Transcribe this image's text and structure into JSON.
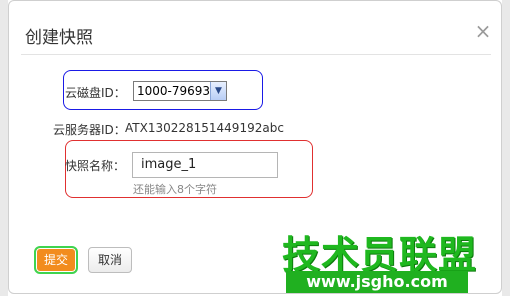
{
  "dialog": {
    "title": "创建快照",
    "close_glyph": "×"
  },
  "disk": {
    "label": "云磁盘ID：",
    "selected": "1000-79693"
  },
  "server": {
    "label": "云服务器ID：",
    "value": "ATX130228151449192abc"
  },
  "snapshot": {
    "label": "快照名称：",
    "value": "image_1",
    "hint": "还能输入8个字符"
  },
  "buttons": {
    "submit": "提交",
    "cancel": "取消"
  },
  "watermark": {
    "text": "技术员联盟",
    "url": "www.jsgho.com"
  },
  "colors": {
    "highlight_blue": "#1a1ae6",
    "highlight_red": "#e03030",
    "submit_orange": "#f28c1e",
    "watermark_green": "#1fb81f"
  }
}
